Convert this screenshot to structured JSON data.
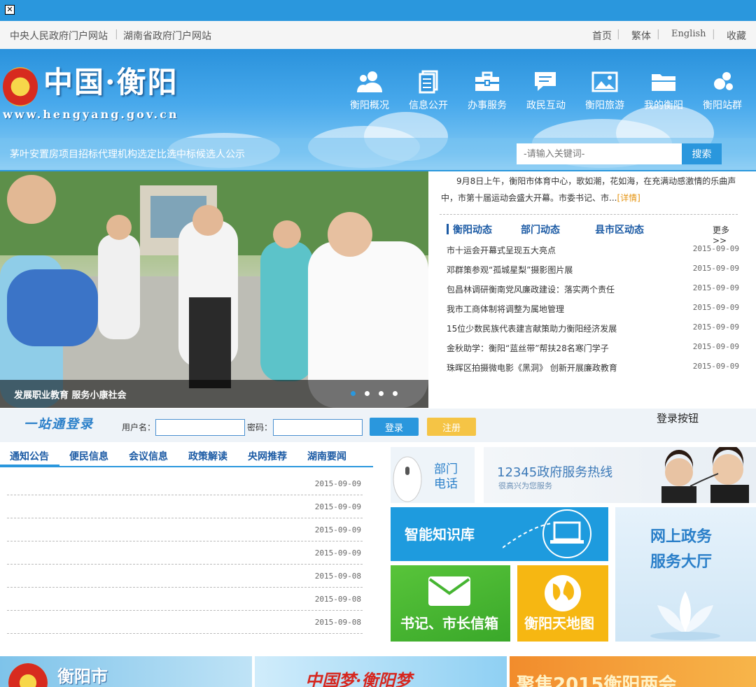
{
  "topbar": {
    "close_glyph": "✕"
  },
  "linkbar": {
    "left": [
      "中央人民政府门户网站",
      "湖南省政府门户网站"
    ],
    "right": [
      "首页",
      "繁体",
      "English",
      "收藏"
    ]
  },
  "header": {
    "logo_title": "中国·衡阳",
    "logo_url": "www.hengyang.gov.cn",
    "nav": [
      {
        "label": "衡阳概况",
        "icon": "people-icon"
      },
      {
        "label": "信息公开",
        "icon": "document-icon"
      },
      {
        "label": "办事服务",
        "icon": "briefcase-icon"
      },
      {
        "label": "政民互动",
        "icon": "chat-icon"
      },
      {
        "label": "衡阳旅游",
        "icon": "picture-icon"
      },
      {
        "label": "我的衡阳",
        "icon": "folder-icon"
      },
      {
        "label": "衡阳站群",
        "icon": "network-icon"
      }
    ]
  },
  "search": {
    "notice": "茅叶安置房项目招标代理机构选定比选中标候选人公示",
    "placeholder": "-请输入关键词-",
    "button": "搜索"
  },
  "slider": {
    "caption": "发展职业教育 服务小康社会",
    "dots": 4,
    "active_dot": 1
  },
  "news": {
    "summary": "9月8日上午，衡阳市体育中心，歌如潮，花如海，在充满动感激情的乐曲声中，市第十届运动会盛大开幕。市委书记、市...",
    "detail_link": "[详情]",
    "tabs": [
      "衡阳动态",
      "部门动态",
      "县市区动态"
    ],
    "more": "更多>>",
    "items": [
      {
        "title": "市十运会开幕式呈现五大亮点",
        "date": "2015-09-09"
      },
      {
        "title": "邓群策参观“孤城星梨”摄影图片展",
        "date": "2015-09-09"
      },
      {
        "title": "包昌林调研衡南党风廉政建设：落实两个责任",
        "date": "2015-09-09"
      },
      {
        "title": "我市工商体制将调整为属地管理",
        "date": "2015-09-09"
      },
      {
        "title": "15位少数民族代表建言献策助力衡阳经济发展",
        "date": "2015-09-09"
      },
      {
        "title": "金秋助学：衡阳“蓝丝带”帮扶28名寒门学子",
        "date": "2015-09-09"
      },
      {
        "title": "珠晖区拍摄微电影《黑洞》 创新开展廉政教育",
        "date": "2015-09-09"
      }
    ]
  },
  "login": {
    "logo": "一站通登录",
    "username_label": "用户名：",
    "password_label": "密码：",
    "login_button": "登录",
    "register_button": "注册",
    "alt_text": "登录按钮"
  },
  "notices": {
    "tabs": [
      "通知公告",
      "便民信息",
      "会议信息",
      "政策解读",
      "央网推荐",
      "湖南要闻"
    ],
    "dates": [
      "2015-09-09",
      "2015-09-09",
      "2015-09-09",
      "2015-09-09",
      "2015-09-08",
      "2015-09-08",
      "2015-09-08"
    ]
  },
  "tiles": {
    "dept_phone": "部门\n电话",
    "hotline_title": "12345政府服务热线",
    "hotline_sub": "很高兴为您服务",
    "knowledge": "智能知识库",
    "online_gov": "网上政务\n服务大厅",
    "mailbox": "书记、市长信箱",
    "map": "衡阳天地图"
  },
  "banners": {
    "b1": "衡阳市",
    "b2": "中国梦·衡阳梦",
    "b3": "聚焦2015衡阳两会"
  },
  "colors": {
    "brand_blue": "#2a97dd",
    "link_blue": "#1b5aa4",
    "green": "#5bc236",
    "orange": "#f7b81a"
  }
}
